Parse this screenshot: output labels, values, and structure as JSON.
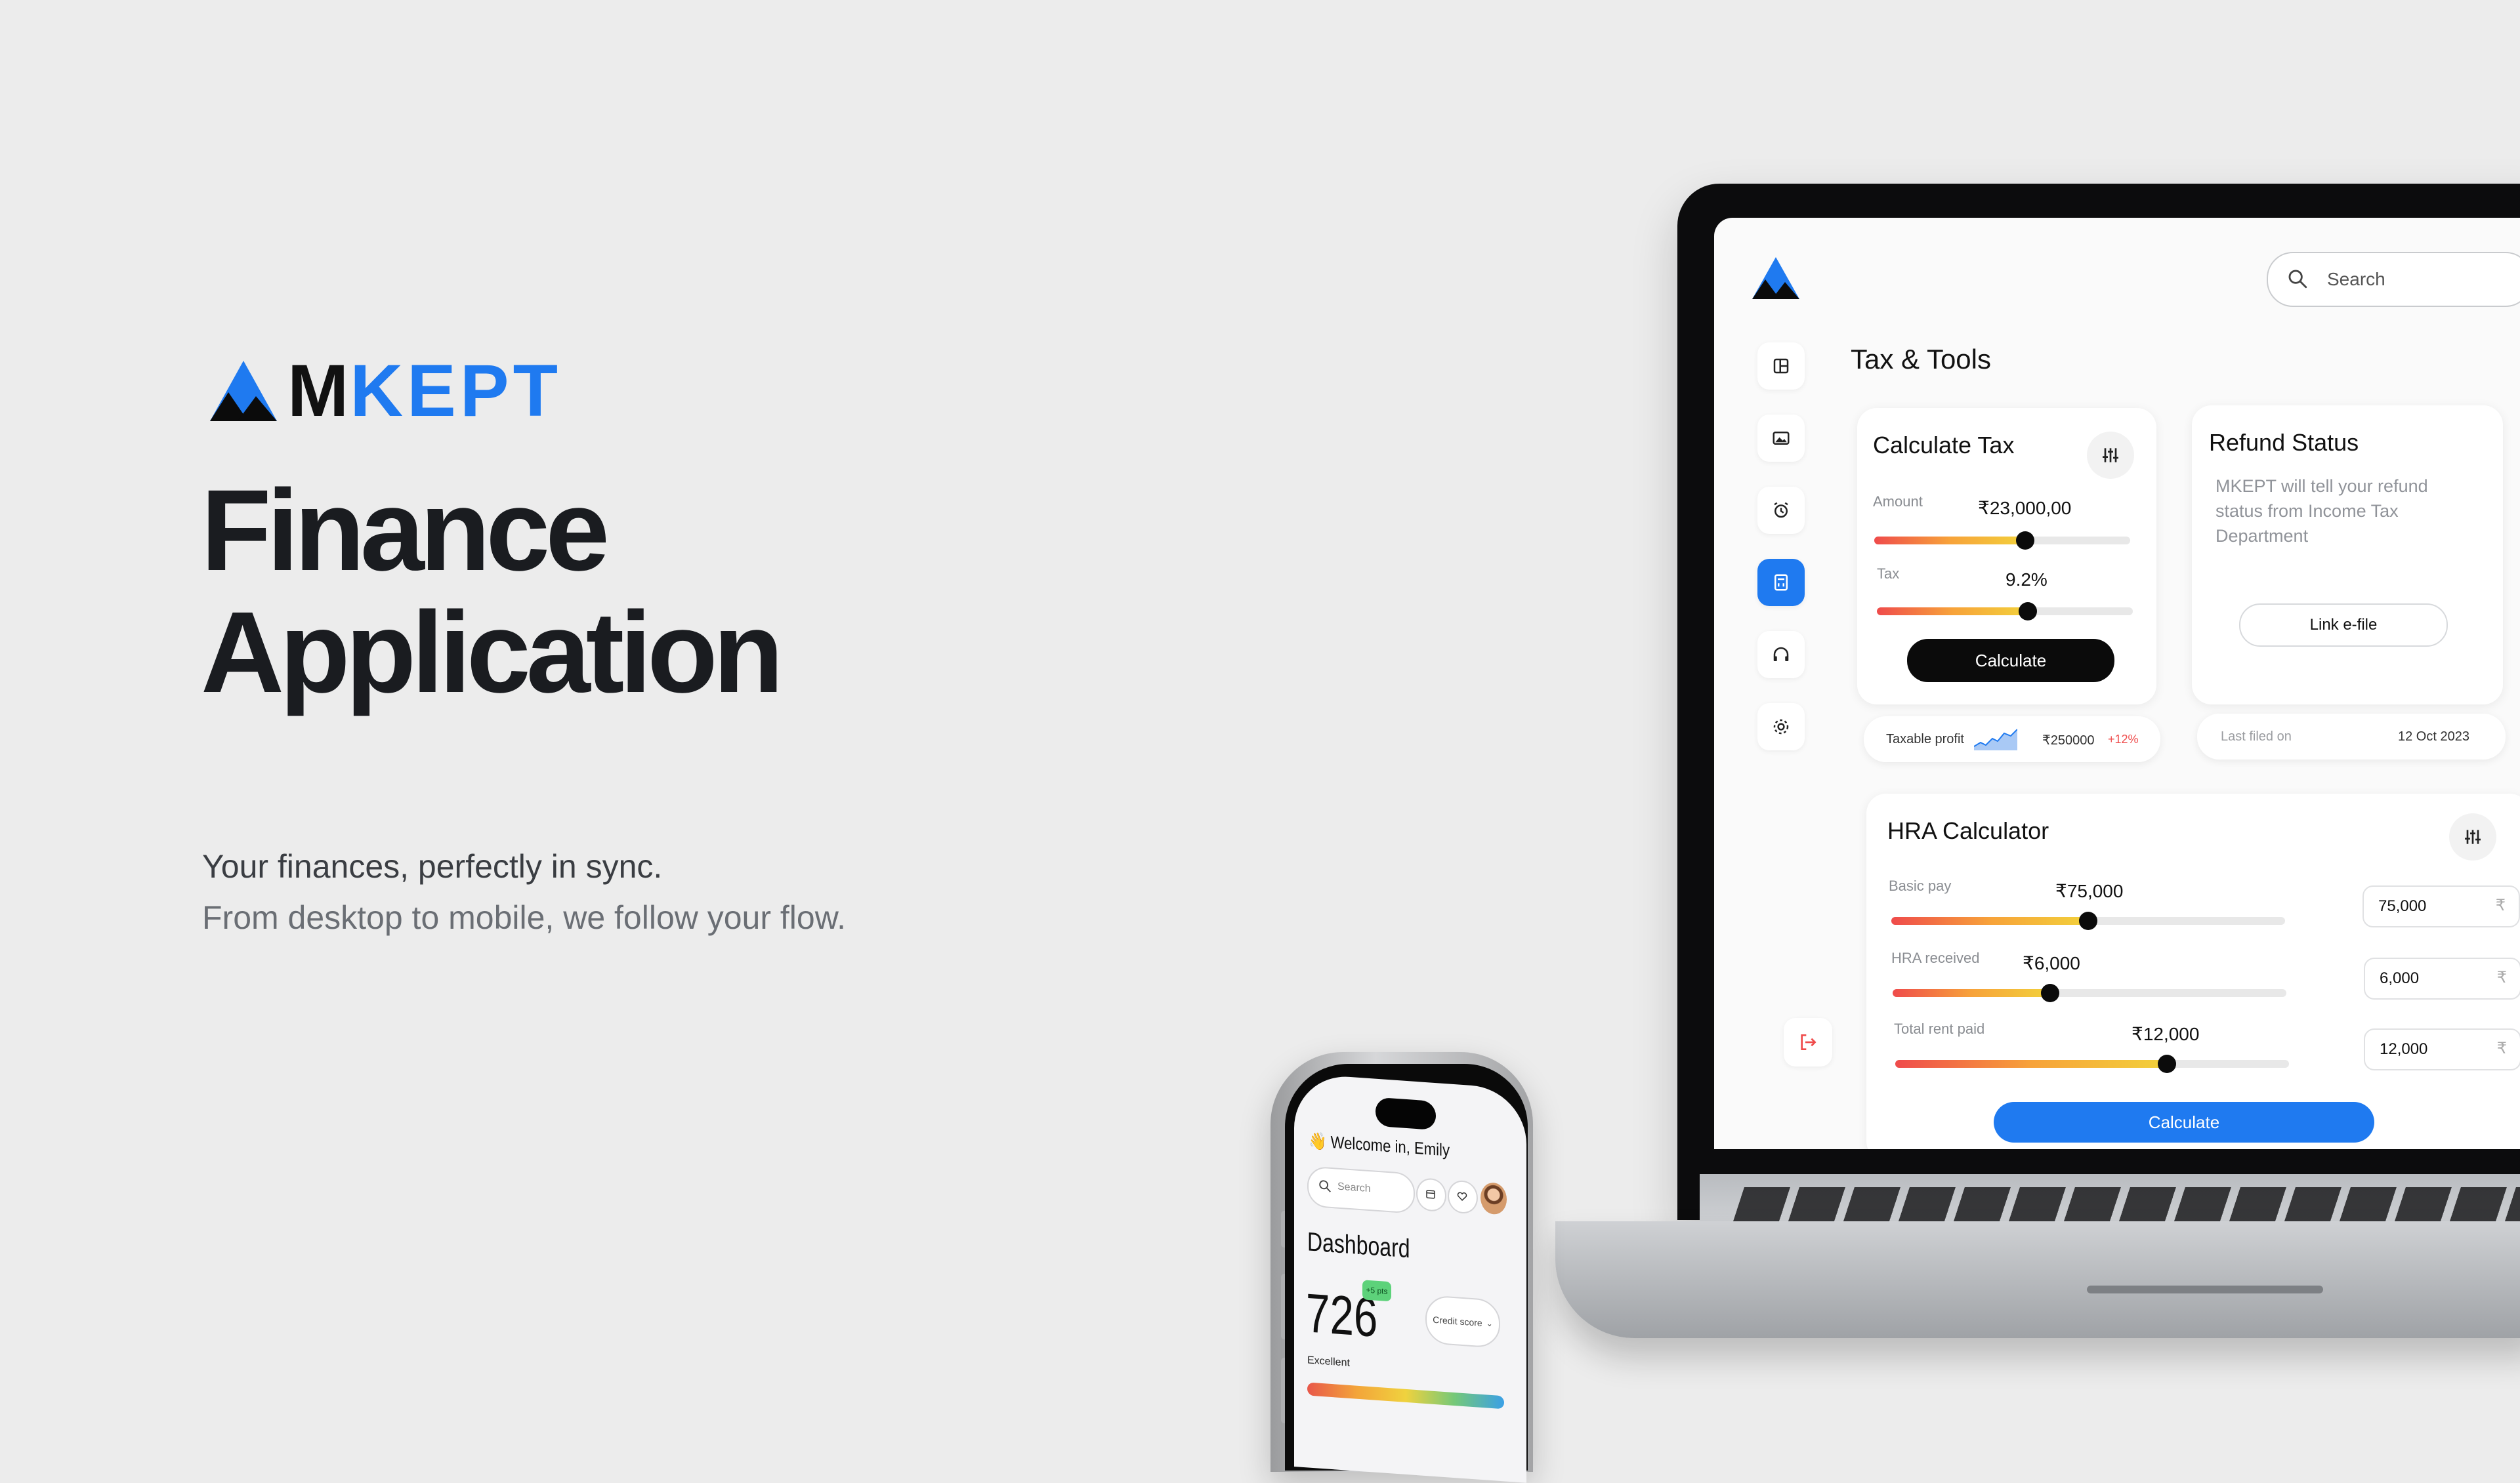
{
  "hero": {
    "brand_m": "M",
    "brand_rest": "KEPT",
    "title_line1": "Finance",
    "title_line2": "Application",
    "tagline1": "Your finances, perfectly in sync.",
    "tagline2": "From desktop to mobile, we follow your flow."
  },
  "desktop": {
    "search_placeholder": "Search",
    "page_title": "Tax & Tools",
    "nav_icons": [
      "layout-icon",
      "image-icon",
      "alarm-icon",
      "calculator-icon",
      "headphones-icon",
      "gear-icon"
    ],
    "active_nav": "calculator-icon",
    "calculate_tax": {
      "title": "Calculate Tax",
      "amount_label": "Amount",
      "amount_value": "₹23,000,00",
      "amount_level": 0.59,
      "tax_label": "Tax",
      "tax_value": "9.2%",
      "tax_level": 0.59,
      "button": "Calculate"
    },
    "taxable_profit": {
      "label": "Taxable profit",
      "value": "₹250000",
      "change": "+12%"
    },
    "refund_status": {
      "title": "Refund Status",
      "description": "MKEPT will tell your refund status from Income Tax Department",
      "button": "Link e-file",
      "last_filed_label": "Last filed on",
      "last_filed_value": "12 Oct 2023"
    },
    "hra_calculator": {
      "title": "HRA Calculator",
      "rows": [
        {
          "label": "Basic pay",
          "value": "₹75,000",
          "input": "75,000",
          "level": 0.5
        },
        {
          "label": "HRA received",
          "value": "₹6,000",
          "input": "6,000",
          "level": 0.4
        },
        {
          "label": "Total rent paid",
          "value": "₹12,000",
          "input": "12,000",
          "level": 0.69
        }
      ],
      "currency": "₹",
      "button": "Calculate"
    }
  },
  "mobile": {
    "welcome": "Welcome in, Emily",
    "search_placeholder": "Search",
    "dashboard_title": "Dashboard",
    "score": "726",
    "score_badge": "+5 pts",
    "credit_dropdown": "Credit score",
    "rating": "Excellent"
  },
  "colors": {
    "accent": "#1f7af0",
    "background": "#ececec",
    "slider_gradient": [
      "#ef4b4b",
      "#f7a23a",
      "#f2d13b"
    ]
  }
}
